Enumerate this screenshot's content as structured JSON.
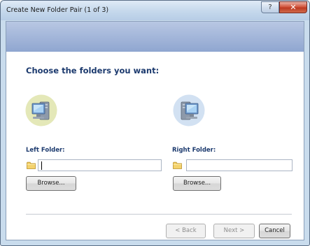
{
  "window": {
    "title": "Create New Folder Pair (1 of 3)",
    "help_label": "?",
    "close_label": "✕"
  },
  "main": {
    "heading": "Choose the folders you want:",
    "left": {
      "label": "Left Folder:",
      "value": "",
      "browse_label": "Browse..."
    },
    "right": {
      "label": "Right Folder:",
      "value": "",
      "browse_label": "Browse..."
    }
  },
  "footer": {
    "back_label": "< Back",
    "next_label": "Next >",
    "cancel_label": "Cancel"
  },
  "colors": {
    "banner": "#9fb3da",
    "heading": "#1c3a6e",
    "close_button": "#c9452c"
  },
  "icons": [
    "help-icon",
    "close-icon",
    "computer-icon",
    "folder-icon"
  ]
}
